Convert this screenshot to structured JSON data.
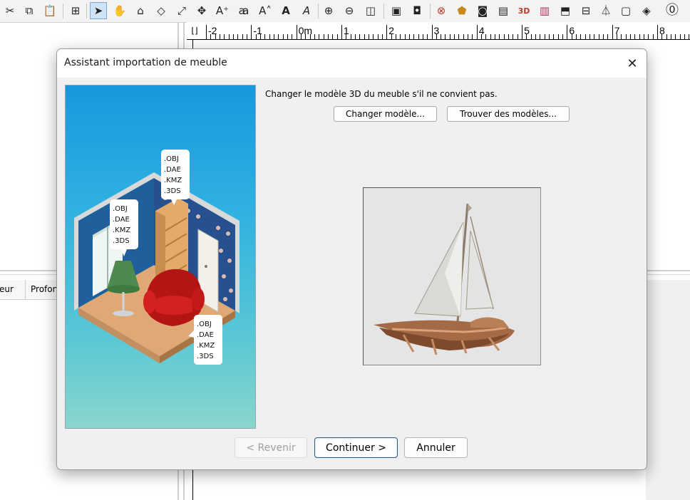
{
  "toolbar": {
    "icons": [
      "cut-icon",
      "copy-icon",
      "paste-icon",
      "add-furniture-icon",
      "select-arrow-icon",
      "pan-hand-icon",
      "create-walls-icon",
      "create-rooms-icon",
      "create-polylines-icon",
      "create-dimensions-icon",
      "add-text-icon",
      "increase-text-size-icon",
      "decrease-text-size-icon",
      "bold-text-icon",
      "italic-text-icon",
      "zoom-in-icon",
      "zoom-out-icon",
      "create-photo-icon",
      "aerial-view-icon",
      "virtual-visit-icon",
      "import-furniture-icon",
      "modify-furniture-icon",
      "photo-camera-icon",
      "video-icon",
      "3d-view-icon",
      "export-icon",
      "preferences-icon",
      "flip-icon",
      "help-icon"
    ]
  },
  "ruler": {
    "labels": [
      "-2",
      "-1",
      "0m",
      "1",
      "2",
      "3",
      "4",
      "5",
      "6",
      "7",
      "8"
    ]
  },
  "furniture_table": {
    "columns": [
      "eur",
      "Profon"
    ]
  },
  "dialog": {
    "title": "Assistant importation de meuble",
    "close_glyph": "✕",
    "instruction": "Changer le modèle 3D du meuble s'il ne convient pas.",
    "change_model_label": "Changer modèle...",
    "find_models_label": "Trouver des modèles...",
    "back_label": "< Revenir",
    "continue_label": "Continuer >",
    "cancel_label": "Annuler",
    "formats": {
      "top": [
        ".OBJ",
        ".DAE",
        ".KMZ",
        ".3DS"
      ],
      "left": [
        ".OBJ",
        ".DAE",
        ".KMZ",
        ".3DS"
      ],
      "bottom": [
        ".OBJ",
        ".DAE",
        ".KMZ",
        ".3DS"
      ]
    },
    "colors": {
      "illustration_sky_top": "#1798de",
      "illustration_sky_bottom": "#8ad6cc",
      "armchair": "#c41a1a",
      "lamp": "#4e8a4e"
    }
  }
}
